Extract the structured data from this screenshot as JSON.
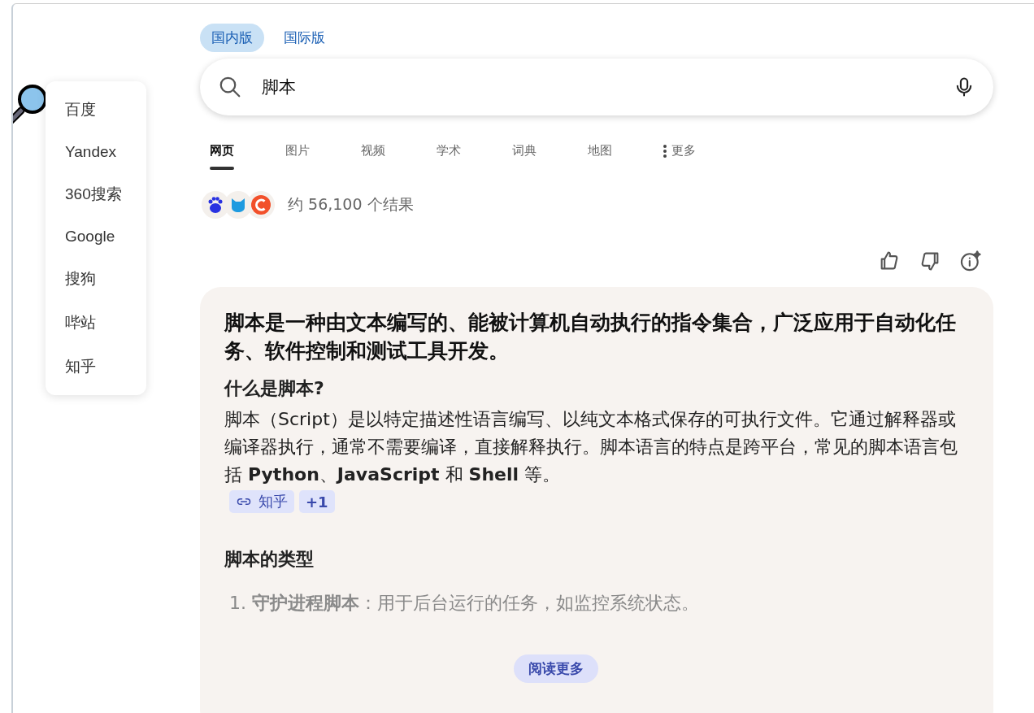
{
  "region_tabs": [
    {
      "label": "国内版",
      "selected": true
    },
    {
      "label": "国际版",
      "selected": false
    }
  ],
  "search": {
    "value": "脚本"
  },
  "nav_tabs": [
    {
      "label": "网页",
      "selected": true
    },
    {
      "label": "图片",
      "selected": false
    },
    {
      "label": "视频",
      "selected": false
    },
    {
      "label": "学术",
      "selected": false
    },
    {
      "label": "词典",
      "selected": false
    },
    {
      "label": "地图",
      "selected": false
    },
    {
      "label": "更多",
      "selected": false,
      "kind": "more"
    }
  ],
  "result_count": "约 56,100 个结果",
  "engine_menu": {
    "items": [
      "百度",
      "Yandex",
      "360搜索",
      "Google",
      "搜狗",
      "哔站",
      "知乎"
    ]
  },
  "answer": {
    "headline": "脚本是一种由文本编写的、能被计算机自动执行的指令集合，广泛应用于自动化任务、软件控制和测试工具开发。",
    "sections": [
      {
        "heading": "什么是脚本?",
        "paragraph": "脚本（Script）是以特定描述性语言编写、以纯文本格式保存的可执行文件。它通过解释器或编译器执行，通常不需要编译，直接解释执行。脚本语言的特点是跨平台，常见的脚本语言包括 **Python**、**JavaScript** 和 **Shell** 等。",
        "sources": [
          "知乎"
        ],
        "more_sources": "+1"
      },
      {
        "heading": "脚本的类型",
        "list": [
          {
            "number": "1.",
            "text": "**守护进程脚本**：用于后台运行的任务，如监控系统状态。"
          }
        ]
      }
    ],
    "read_more": "阅读更多"
  }
}
